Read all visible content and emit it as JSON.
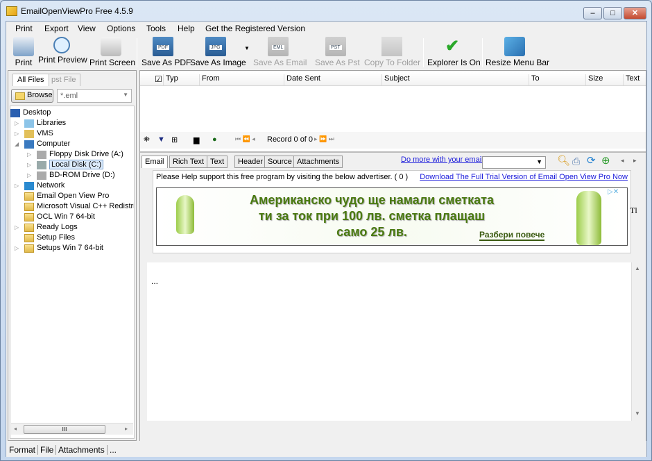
{
  "window": {
    "title": "EmailOpenViewPro Free 4.5.9",
    "minimize": "‒",
    "maximize": "□",
    "close": "✕"
  },
  "menu": [
    "Print",
    "Export",
    "View",
    "Options",
    "Tools",
    "Help",
    "Get the Registered Version"
  ],
  "toolbar": [
    {
      "label": "Print",
      "icon": "printer-icon",
      "enabled": true
    },
    {
      "label": "Print Preview",
      "icon": "magnifier-page-icon",
      "enabled": true
    },
    {
      "label": "Print Screen",
      "icon": "camera-icon",
      "enabled": true
    },
    {
      "label": "Save As PDF",
      "icon": "floppy-pdf-icon",
      "enabled": true
    },
    {
      "label": "Save As Image",
      "icon": "floppy-jpg-icon",
      "enabled": true
    },
    {
      "label": "Save As Email",
      "icon": "floppy-email-icon",
      "enabled": false
    },
    {
      "label": "Save As Pst",
      "icon": "floppy-pst-icon",
      "enabled": false
    },
    {
      "label": "Copy To Folder",
      "icon": "copy-folder-icon",
      "enabled": false
    },
    {
      "label": "Explorer Is On",
      "icon": "checkmark-icon",
      "enabled": true
    },
    {
      "label": "Resize Menu Bar",
      "icon": "resize-icon",
      "enabled": true
    }
  ],
  "left": {
    "tabs": [
      "All Files",
      "pst File"
    ],
    "browse": "Browse",
    "filter": "*.eml",
    "tree": [
      {
        "label": "Desktop",
        "level": 0,
        "icon": "desktop-icon"
      },
      {
        "label": "Libraries",
        "level": 1,
        "icon": "libraries-icon"
      },
      {
        "label": "VMS",
        "level": 1,
        "icon": "user-folder-icon"
      },
      {
        "label": "Computer",
        "level": 1,
        "icon": "computer-icon"
      },
      {
        "label": "Floppy Disk Drive (A:)",
        "level": 2,
        "icon": "floppy-drive-icon"
      },
      {
        "label": "Local Disk (C:)",
        "level": 2,
        "icon": "local-disk-icon",
        "selected": true
      },
      {
        "label": "BD-ROM Drive (D:)",
        "level": 2,
        "icon": "bd-rom-icon"
      },
      {
        "label": "Network",
        "level": 1,
        "icon": "network-icon"
      },
      {
        "label": "Email Open View Pro",
        "level": 1,
        "icon": "folder-icon"
      },
      {
        "label": "Microsoft Visual C++ Redistribut",
        "level": 1,
        "icon": "folder-icon"
      },
      {
        "label": "OCL Win 7 64-bit",
        "level": 1,
        "icon": "folder-icon"
      },
      {
        "label": "Ready Logs",
        "level": 1,
        "icon": "folder-icon"
      },
      {
        "label": "Setup Files",
        "level": 1,
        "icon": "folder-icon"
      },
      {
        "label": "Setups Win 7 64-bit",
        "level": 1,
        "icon": "folder-icon"
      }
    ],
    "scroll_thumb": "III"
  },
  "grid": {
    "columns": [
      "Typ",
      "From",
      "Date Sent",
      "Subject",
      "To",
      "Size",
      "Text"
    ],
    "record": "Record 0 of 0"
  },
  "detail": {
    "tabs": [
      "Email",
      "Rich Text",
      "Text",
      "Header",
      "Source",
      "Attachments"
    ],
    "link_more": "Do more with your email.",
    "support_note": "Please Help support this free program by visiting the below advertiser. ( 0 )",
    "download_link": "Download The Full Trial Version of Email Open View Pro Now",
    "ad": {
      "lines": [
        "Американско чудо ще намали сметката",
        "ти за ток при 100 лв. сметка плащаш",
        "само 25 лв."
      ],
      "cta": "Разбери повече",
      "side_text": "Tl"
    },
    "body_text": "..."
  },
  "status": [
    "Format",
    "File",
    "Attachments",
    "..."
  ]
}
